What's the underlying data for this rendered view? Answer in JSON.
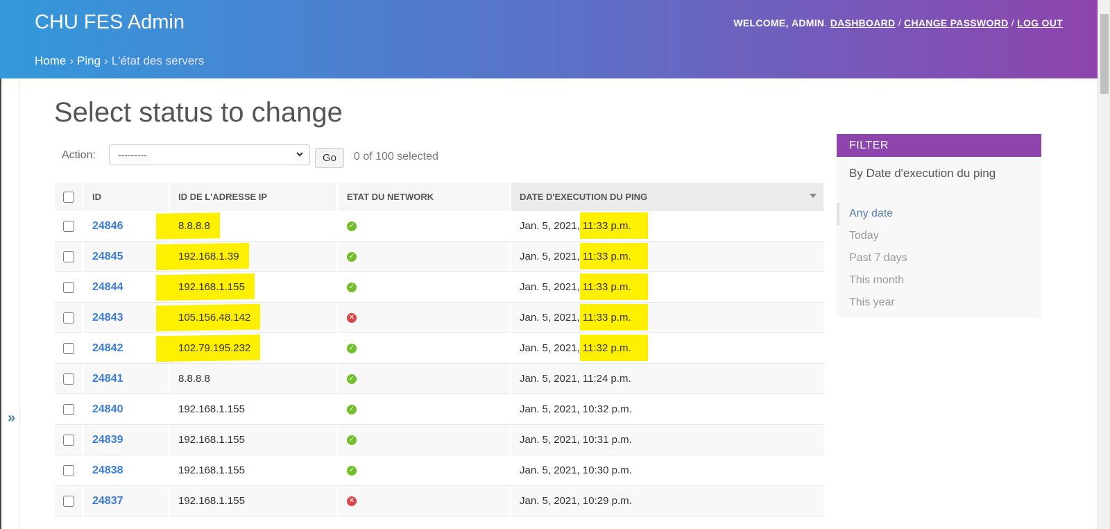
{
  "header": {
    "brand": "CHU FES Admin",
    "welcome": "WELCOME,",
    "user": "ADMIN",
    "dot": ".",
    "links": [
      "DASHBOARD",
      "CHANGE PASSWORD",
      "LOG OUT"
    ],
    "separator": "/"
  },
  "breadcrumbs": {
    "home": "Home",
    "app": "Ping",
    "current": "L'état des servers",
    "sep": "›"
  },
  "sidebar_toggle": "»",
  "page_title": "Select status to change",
  "actions": {
    "label": "Action:",
    "selected": "---------",
    "go": "Go",
    "counter": "0 of 100 selected"
  },
  "table": {
    "headers": [
      "ID",
      "ID DE L'ADRESSE IP",
      "ETAT DU NETWORK",
      "DATE D'EXECUTION DU PING"
    ],
    "rows": [
      {
        "id": "24846",
        "ip": "8.8.8.8",
        "ok": true,
        "date": "Jan. 5, 2021,",
        "time": "11:33 p.m.",
        "highlight": true
      },
      {
        "id": "24845",
        "ip": "192.168.1.39",
        "ok": true,
        "date": "Jan. 5, 2021,",
        "time": "11:33 p.m.",
        "highlight": true
      },
      {
        "id": "24844",
        "ip": "192.168.1.155",
        "ok": true,
        "date": "Jan. 5, 2021,",
        "time": "11:33 p.m.",
        "highlight": true
      },
      {
        "id": "24843",
        "ip": "105.156.48.142",
        "ok": false,
        "date": "Jan. 5, 2021,",
        "time": "11:33 p.m.",
        "highlight": true
      },
      {
        "id": "24842",
        "ip": "102.79.195.232",
        "ok": true,
        "date": "Jan. 5, 2021,",
        "time": "11:32 p.m.",
        "highlight": true
      },
      {
        "id": "24841",
        "ip": "8.8.8.8",
        "ok": true,
        "date": "Jan. 5, 2021,",
        "time": "11:24 p.m.",
        "highlight": false
      },
      {
        "id": "24840",
        "ip": "192.168.1.155",
        "ok": true,
        "date": "Jan. 5, 2021,",
        "time": "10:32 p.m.",
        "highlight": false
      },
      {
        "id": "24839",
        "ip": "192.168.1.155",
        "ok": true,
        "date": "Jan. 5, 2021,",
        "time": "10:31 p.m.",
        "highlight": false
      },
      {
        "id": "24838",
        "ip": "192.168.1.155",
        "ok": true,
        "date": "Jan. 5, 2021,",
        "time": "10:30 p.m.",
        "highlight": false
      },
      {
        "id": "24837",
        "ip": "192.168.1.155",
        "ok": false,
        "date": "Jan. 5, 2021,",
        "time": "10:29 p.m.",
        "highlight": false
      }
    ],
    "ok_glyph": "✓",
    "bad_glyph": "✕"
  },
  "filter": {
    "title": "FILTER",
    "heading": "By Date d'execution du ping",
    "options": [
      "Any date",
      "Today",
      "Past 7 days",
      "This month",
      "This year"
    ],
    "selected": "Any date"
  },
  "colors": {
    "header_start": "#3498db",
    "header_end": "#8e44ad",
    "highlight": "#fff000",
    "link": "#3b7dd8",
    "ok": "#70bf2b",
    "error": "#dd4646"
  }
}
